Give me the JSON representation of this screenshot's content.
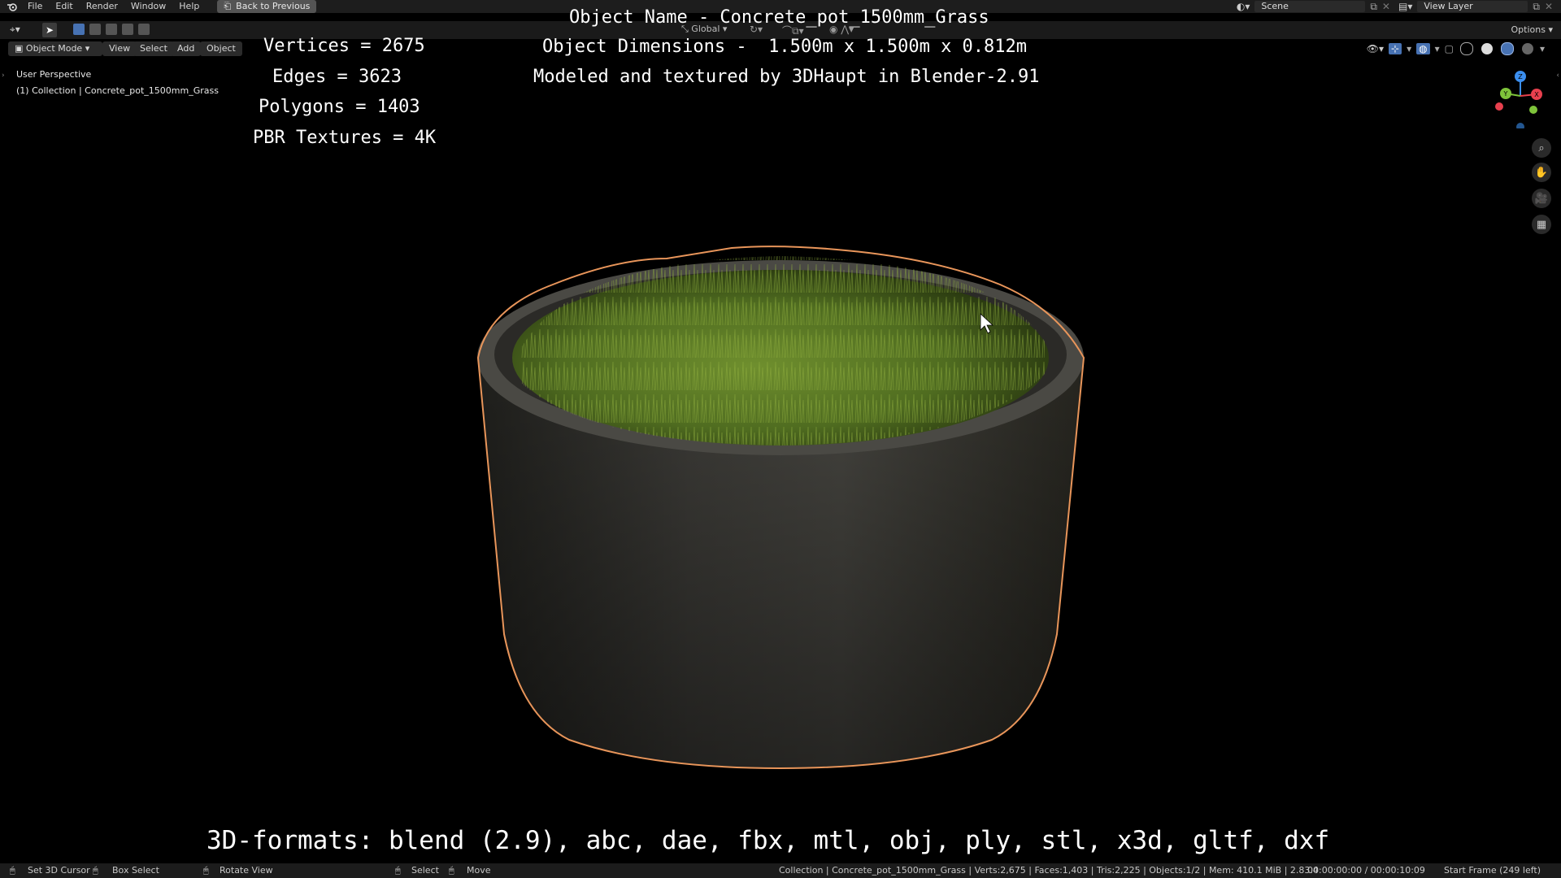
{
  "menu": {
    "items": [
      "File",
      "Edit",
      "Render",
      "Window",
      "Help"
    ],
    "back_button": "Back to Previous"
  },
  "top_right": {
    "scene_label": "Scene",
    "view_layer_label": "View Layer"
  },
  "toolbar": {
    "transform_orientation": "Global",
    "options_label": "Options"
  },
  "header": {
    "mode": "Object Mode",
    "buttons": [
      "View",
      "Select",
      "Add",
      "Object"
    ]
  },
  "viewport": {
    "perspective": "User Perspective",
    "collection": "(1) Collection | Concrete_pot_1500mm_Grass"
  },
  "overlay": {
    "stats": [
      "Vertices = 2675",
      "Edges = 3623",
      "Polygons = 1403",
      "PBR Textures = 4K"
    ],
    "object_name": "Object Name - Concrete_pot_1500mm_Grass",
    "dimensions": "Object Dimensions -  1.500m x 1.500m x 0.812m",
    "credit": "Modeled and textured by 3DHaupt in Blender-2.91",
    "formats": "3D-formats: blend (2.9), abc, dae, fbx, mtl, obj, ply, stl, x3d, gltf, dxf"
  },
  "gizmo": {
    "axes": [
      "X",
      "Y",
      "Z"
    ],
    "colors": {
      "x": "#e8404e",
      "y": "#7ec43a",
      "z": "#3b8ff0"
    }
  },
  "status": {
    "set_cursor": "Set 3D Cursor",
    "box_select": "Box Select",
    "rotate_view": "Rotate View",
    "select": "Select",
    "move": "Move",
    "stats": "Collection | Concrete_pot_1500mm_Grass | Verts:2,675 | Faces:1,403 | Tris:2,225 | Objects:1/2 | Mem: 410.1 MiB | 2.83.4",
    "time": "00:00:00:00 / 00:00:10:09",
    "frame": "Start Frame (249 left)"
  },
  "colors": {
    "selection_outline": "#e8955a",
    "grass": "#5a7a26",
    "pot": "#3a3935"
  }
}
